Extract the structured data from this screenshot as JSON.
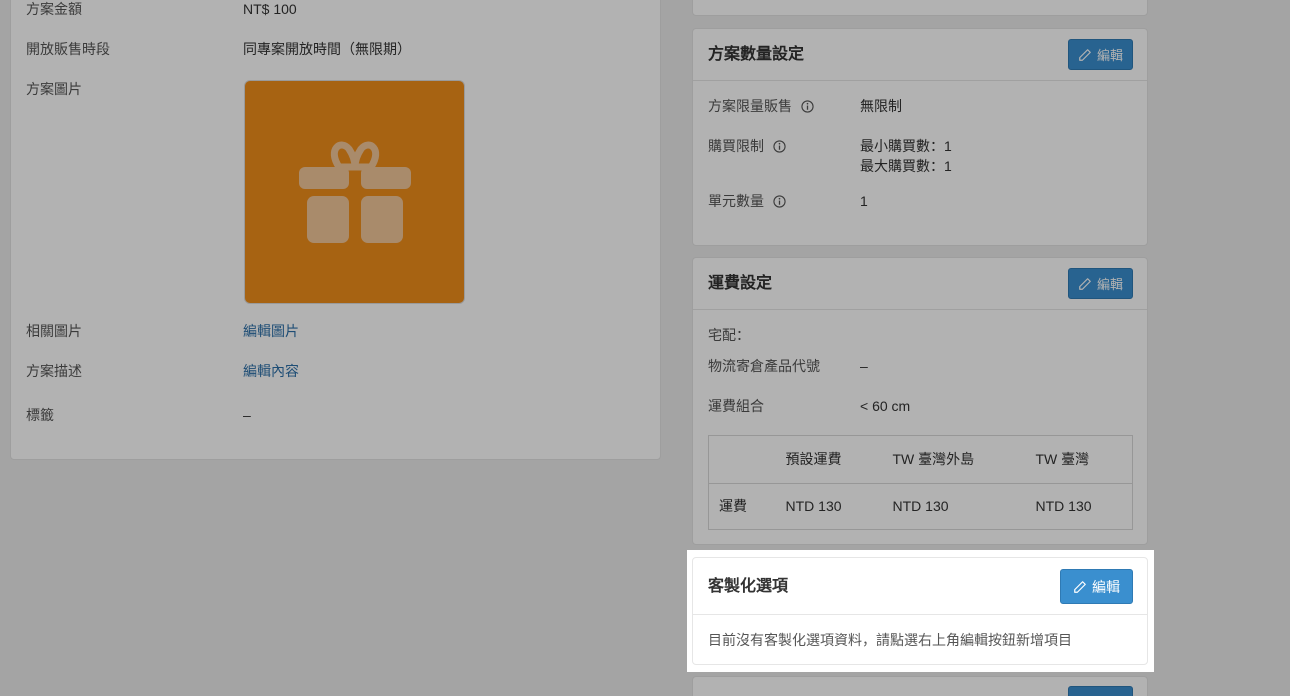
{
  "left_panel": {
    "rows": [
      {
        "label": "方案金額",
        "value": "NT$ 100"
      },
      {
        "label": "開放販售時段",
        "value": "同專案開放時間（無限期）"
      },
      {
        "label": "方案圖片",
        "value": ""
      },
      {
        "label": "相關圖片",
        "value": "編輯圖片"
      },
      {
        "label": "方案描述",
        "value": "編輯內容"
      },
      {
        "label": "標籤",
        "value": "–"
      }
    ],
    "image": {
      "icon": "gift-icon",
      "bg_color": "#f08e1b"
    }
  },
  "quantity_card": {
    "title": "方案數量設定",
    "edit_label": "編輯",
    "rows": [
      {
        "label": "方案限量販售",
        "value": "無限制"
      },
      {
        "label": "購買限制",
        "value_lines": [
          "最小購買數：1",
          "最大購買數：1"
        ]
      },
      {
        "label": "單元數量",
        "value": "1"
      }
    ]
  },
  "shipping_card": {
    "title": "運費設定",
    "edit_label": "編輯",
    "delivery_label": "宅配：",
    "rows": [
      {
        "label": "物流寄倉產品代號",
        "value": "–"
      },
      {
        "label": "運費組合",
        "value": "< 60 cm"
      }
    ],
    "table": {
      "headers": [
        "",
        "預設運費",
        "TW 臺灣外島",
        "TW 臺灣"
      ],
      "row": [
        "運費",
        "NTD 130",
        "NTD 130",
        "NTD 130"
      ]
    }
  },
  "custom_card": {
    "title": "客製化選項",
    "edit_label": "編輯",
    "empty_message": "目前沒有客製化選項資料，請點選右上角編輯按鈕新增項目"
  },
  "colors": {
    "accent": "#3a8fcf",
    "link": "#2b6fa8",
    "overlay": "rgba(0,0,0,0.30)"
  }
}
